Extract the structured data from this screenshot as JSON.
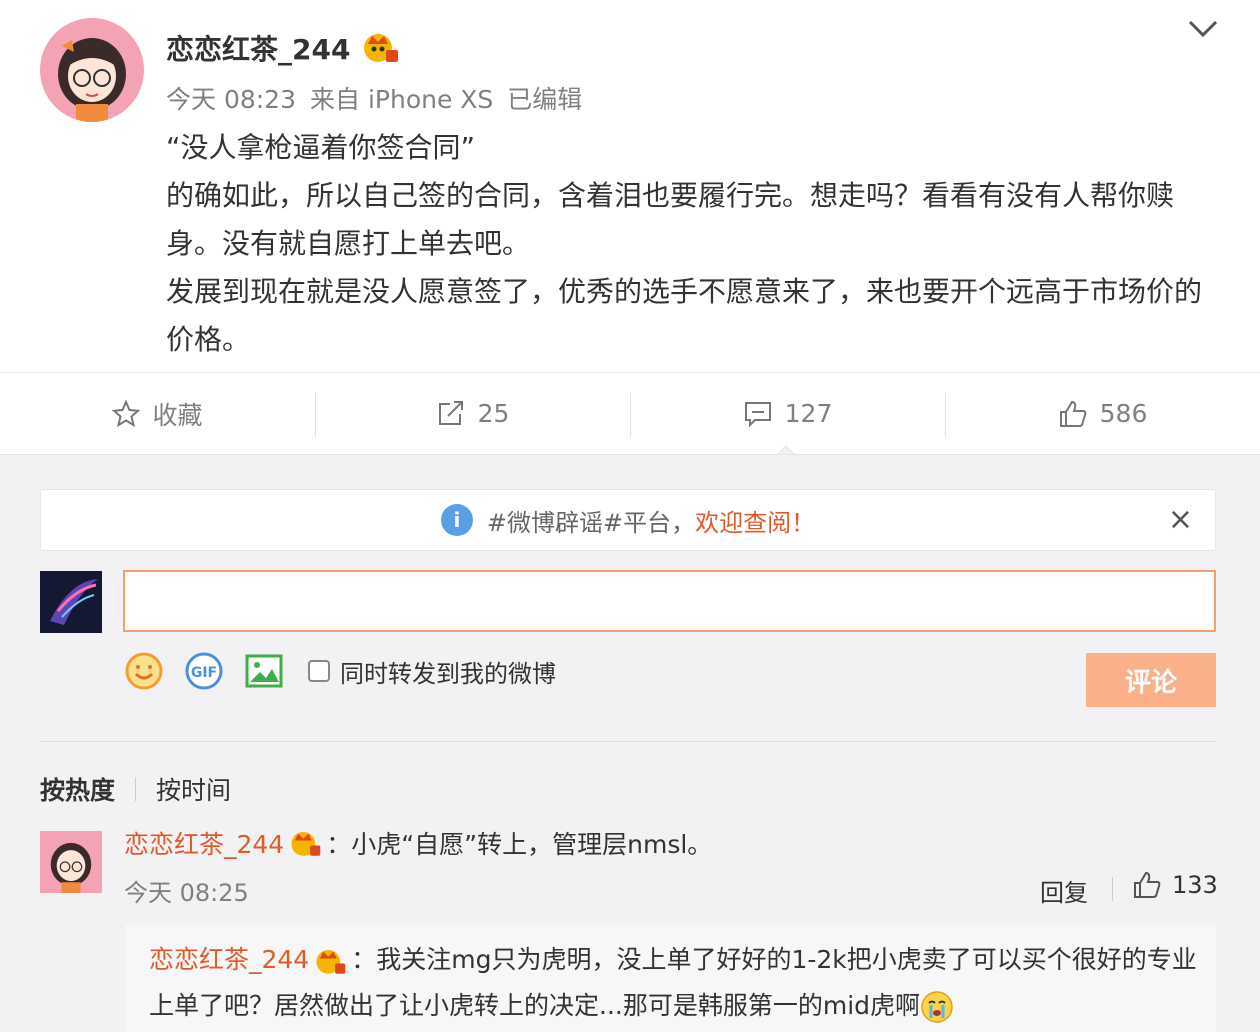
{
  "post": {
    "author": "恋恋红茶_244",
    "time": "今天 08:23",
    "source": "来自 iPhone XS",
    "edited": "已编辑",
    "lines": [
      "“没人拿枪逼着你签合同”",
      "的确如此，所以自己签的合同，含着泪也要履行完。想走吗？看看有没有人帮你赎身。没有就自愿打上单去吧。",
      "发展到现在就是没人愿意签了，优秀的选手不愿意来了，来也要开个远高于市场价的价格。"
    ]
  },
  "actions": {
    "favorite": "收藏",
    "repost": "25",
    "comment": "127",
    "like": "586"
  },
  "notice": {
    "text": "#微博辟谣#平台，",
    "link": "欢迎查阅！"
  },
  "composer": {
    "input_value": "",
    "share_label": "同时转发到我的微博",
    "submit": "评论"
  },
  "sort": {
    "hot": "按热度",
    "time": "按时间"
  },
  "comment": {
    "user": "恋恋红茶_244",
    "text": "：小虎“自愿”转上，管理层nmsl。",
    "time": "今天 08:25",
    "reply": "回复",
    "likes": "133"
  },
  "sub_comment": {
    "user": "恋恋红茶_244",
    "text": "：我关注mg只为虎明，没上单了好好的1-2k把小虎卖了可以买个很好的专业上单了吧？居然做出了让小虎转上的决定...那可是韩服第一的mid虎啊"
  },
  "colors": {
    "accent": "#e05a2a",
    "submit_bg": "#fbb08a",
    "input_border": "#f0a06a"
  }
}
